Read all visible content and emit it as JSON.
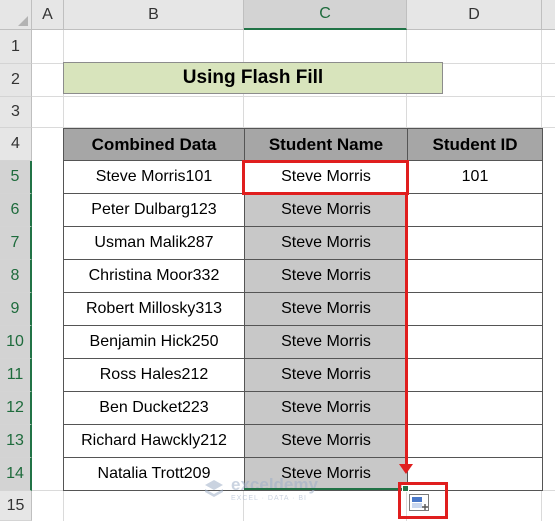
{
  "columns": [
    "A",
    "B",
    "C",
    "D"
  ],
  "rows": [
    "1",
    "2",
    "3",
    "4",
    "5",
    "6",
    "7",
    "8",
    "9",
    "10",
    "11",
    "12",
    "13",
    "14",
    "15"
  ],
  "title": "Using Flash Fill",
  "table": {
    "headers": [
      "Combined Data",
      "Student Name",
      "Student ID"
    ],
    "rows": [
      {
        "combined": "Steve Morris101",
        "name": "Steve Morris",
        "id": "101"
      },
      {
        "combined": "Peter Dulbarg123",
        "name": "Steve Morris",
        "id": ""
      },
      {
        "combined": "Usman Malik287",
        "name": "Steve Morris",
        "id": ""
      },
      {
        "combined": "Christina Moor332",
        "name": "Steve Morris",
        "id": ""
      },
      {
        "combined": "Robert Millosky313",
        "name": "Steve Morris",
        "id": ""
      },
      {
        "combined": "Benjamin Hick250",
        "name": "Steve Morris",
        "id": ""
      },
      {
        "combined": "Ross Hales212",
        "name": "Steve Morris",
        "id": ""
      },
      {
        "combined": "Ben Ducket223",
        "name": "Steve Morris",
        "id": ""
      },
      {
        "combined": "Richard Hawckly212",
        "name": "Steve Morris",
        "id": ""
      },
      {
        "combined": "Natalia Trott209",
        "name": "Steve Morris",
        "id": ""
      }
    ]
  },
  "watermark": {
    "name": "exceldemy",
    "tagline": "EXCEL · DATA · BI"
  },
  "icons": {
    "fill-handle": "fill-handle-icon",
    "flash-fill-options": "auto-fill-options-icon"
  },
  "colors": {
    "title_bg": "#d8e4bc",
    "header_bg": "#a6a6a6",
    "highlight": "#e01e1e",
    "selection": "#217346"
  }
}
